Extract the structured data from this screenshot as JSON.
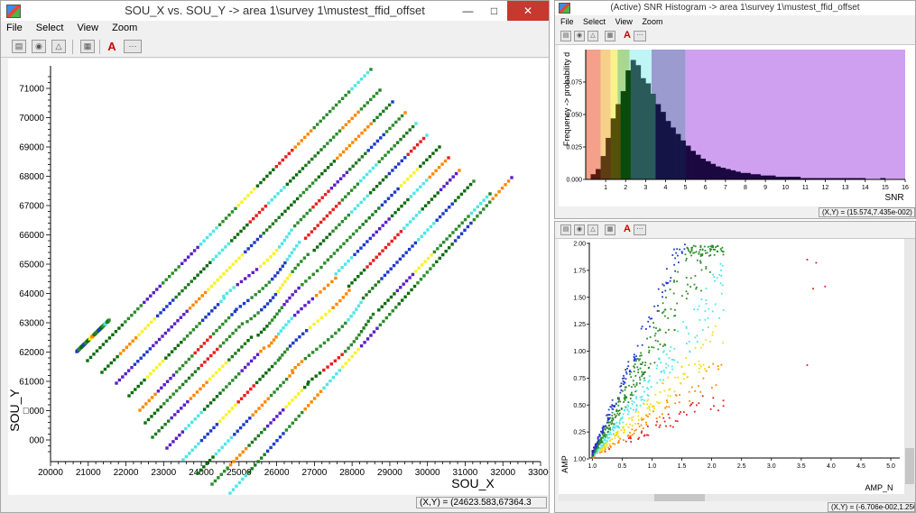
{
  "main": {
    "title": "SOU_X vs. SOU_Y -> area 1\\survey 1\\mustest_ffid_offset",
    "menu": [
      "File",
      "Select",
      "View",
      "Zoom"
    ],
    "xlabel": "SOU_X",
    "ylabel": "SOU_Y",
    "xticks": [
      "20000",
      "21000",
      "22000",
      "23000",
      "24000",
      "25000",
      "26000",
      "27000",
      "28000",
      "29000",
      "30000",
      "31000",
      "32000",
      "33000"
    ],
    "yticks": [
      "71000",
      "70000",
      "69000",
      "68000",
      "67000",
      "66000",
      "65000",
      "64000",
      "63000",
      "62000",
      "61000",
      "\u0000000",
      "000"
    ],
    "status": "(X,Y) = (24623.583,67364.3"
  },
  "hist": {
    "title": "(Active) SNR Histogram -> area 1\\survey 1\\mustest_ffid_offset",
    "menu": [
      "File",
      "Select",
      "View",
      "Zoom"
    ],
    "ylabel": "Frequency -> probability d",
    "xlabel": "SNR",
    "yticks": [
      "0.075",
      "0.050",
      "0.025",
      "0.000"
    ],
    "xticks": [
      "1",
      "2",
      "3",
      "4",
      "5",
      "6",
      "7",
      "8",
      "9",
      "10",
      "11",
      "12",
      "13",
      "14",
      "15",
      "16"
    ],
    "status": "(X,Y) = (15.574,7.435e-002)"
  },
  "scatter": {
    "xlabel": "AMP_N",
    "ylabel": "AMP",
    "yticks": [
      "2.00",
      "1.75",
      "1.50",
      "1.25",
      "1.00",
      "0.75",
      "0.50",
      "0.25",
      "1.00"
    ],
    "xticks": [
      "1.0",
      "0.5",
      "1.0",
      "1.5",
      "2.0",
      "2.5",
      "3.0",
      "3.5",
      "4.0",
      "4.5",
      "5.0"
    ],
    "status": "(X,Y) = (-6.706e-002,1.250)"
  },
  "colors": {
    "band_colors": [
      "#f4a08a",
      "#f7d08a",
      "#f7f28a",
      "#a8d890",
      "#bff5f5",
      "#9b9bd0",
      "#cfa0f0"
    ],
    "line_palette": [
      "#2c8c2c",
      "#2c8c2c",
      "#1f7a1f",
      "#0b6b0b",
      "#4ee6e6",
      "#f7f228",
      "#ff8800",
      "#e62020",
      "#5a1fc8",
      "#1f3ac8"
    ]
  },
  "chart_data": [
    {
      "type": "scatter",
      "title": "",
      "xlabel": "SOU_X",
      "ylabel": "SOU_Y",
      "xlim": [
        20000,
        33000
      ],
      "ylim": [
        60500,
        71000
      ],
      "series": [
        {
          "x": [
            20500,
            22000
          ],
          "y": [
            62000,
            63200
          ]
        },
        {
          "x": [
            21000,
            28800
          ],
          "y": [
            61700,
            71300
          ]
        },
        {
          "x": [
            21500,
            29200
          ],
          "y": [
            61300,
            70700
          ]
        },
        {
          "x": [
            22000,
            29600
          ],
          "y": [
            61000,
            70300
          ]
        },
        {
          "x": [
            22500,
            30000
          ],
          "y": [
            60700,
            69900
          ]
        },
        {
          "x": [
            23000,
            30400
          ],
          "y": [
            60400,
            69500
          ]
        },
        {
          "x": [
            23200,
            30800
          ],
          "y": [
            60000,
            69100
          ]
        },
        {
          "x": [
            23500,
            31100
          ],
          "y": [
            59700,
            68700
          ]
        },
        {
          "x": [
            23800,
            31500
          ],
          "y": [
            59300,
            68300
          ]
        },
        {
          "x": [
            24200,
            31900
          ],
          "y": [
            59000,
            67900
          ]
        },
        {
          "x": [
            24600,
            32300
          ],
          "y": [
            58700,
            67500
          ]
        },
        {
          "x": [
            25000,
            32800
          ],
          "y": [
            58300,
            67100
          ]
        },
        {
          "x": [
            25500,
            33200
          ],
          "y": [
            58000,
            66700
          ]
        }
      ]
    },
    {
      "type": "bar",
      "title": "SNR Histogram",
      "xlabel": "SNR",
      "ylabel": "Frequency -> probability d",
      "xlim": [
        0,
        16
      ],
      "ylim": [
        0,
        0.1
      ],
      "bin_width": 0.25,
      "values": [
        0.0,
        0.004,
        0.008,
        0.018,
        0.032,
        0.047,
        0.058,
        0.068,
        0.084,
        0.092,
        0.088,
        0.078,
        0.074,
        0.066,
        0.058,
        0.052,
        0.045,
        0.04,
        0.035,
        0.03,
        0.026,
        0.022,
        0.019,
        0.016,
        0.014,
        0.012,
        0.01,
        0.009,
        0.008,
        0.007,
        0.006,
        0.005,
        0.005,
        0.004,
        0.004,
        0.003,
        0.003,
        0.003,
        0.002,
        0.002,
        0.002,
        0.002,
        0.002,
        0.001,
        0.001,
        0.001,
        0.001,
        0.001,
        0.001,
        0.001,
        0.001,
        0.001,
        0.001,
        0.001,
        0.001,
        0.001,
        0.0,
        0.0,
        0.0,
        0.001,
        0.0,
        0.0,
        0.0,
        0.0
      ]
    },
    {
      "type": "scatter",
      "title": "",
      "xlabel": "AMP_N",
      "ylabel": "AMP",
      "xlim": [
        -1.0,
        5.0
      ],
      "ylim": [
        0.0,
        2.0
      ]
    }
  ]
}
